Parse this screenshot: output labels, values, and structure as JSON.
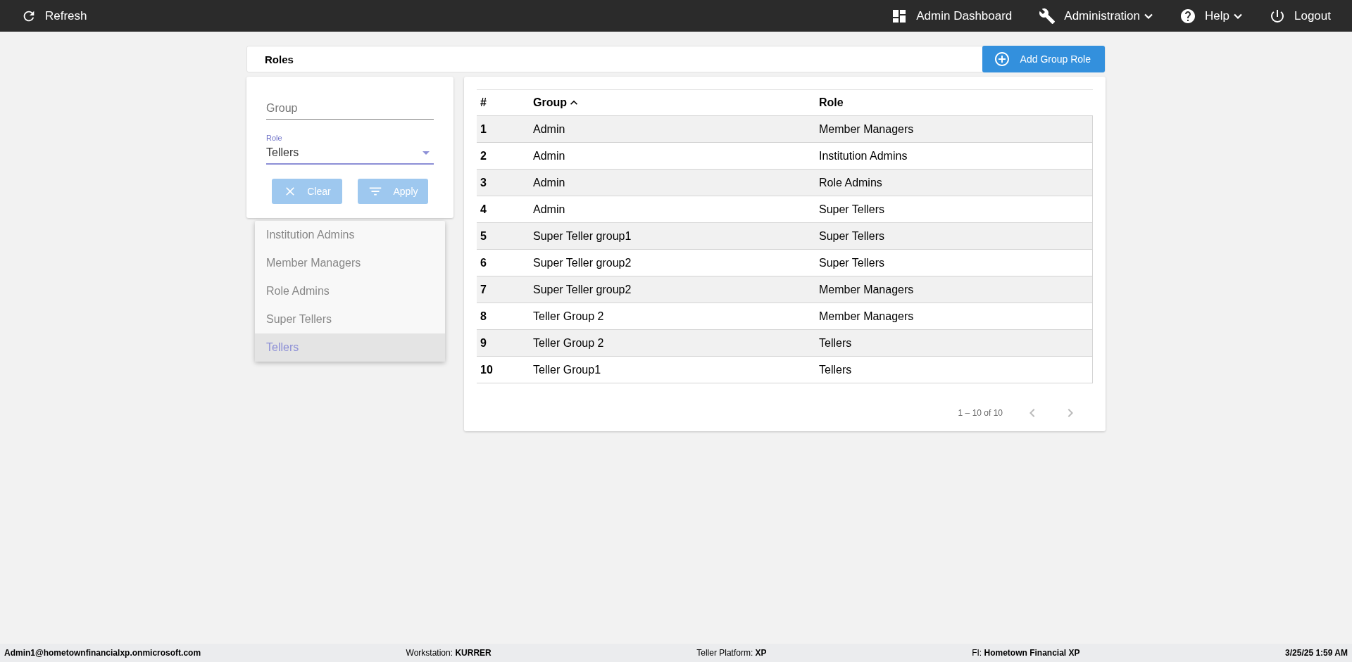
{
  "topbar": {
    "refresh": "Refresh",
    "menu": [
      {
        "kind": "dashboard",
        "label": "Admin Dashboard",
        "dropdown": false
      },
      {
        "kind": "wrench",
        "label": "Administration",
        "dropdown": true
      },
      {
        "kind": "help",
        "label": "Help",
        "dropdown": true
      },
      {
        "kind": "power",
        "label": "Logout",
        "dropdown": false
      }
    ]
  },
  "header": {
    "title": "Roles",
    "add_button": "Add Group Role"
  },
  "filter": {
    "group": {
      "placeholder": "Group"
    },
    "role": {
      "label": "Role",
      "value": "Tellers"
    },
    "clear": "Clear",
    "apply": "Apply",
    "options": [
      {
        "label": "Institution Admins",
        "selected": false
      },
      {
        "label": "Member Managers",
        "selected": false
      },
      {
        "label": "Role Admins",
        "selected": false
      },
      {
        "label": "Super Tellers",
        "selected": false
      },
      {
        "label": "Tellers",
        "selected": true
      }
    ]
  },
  "table": {
    "columns": [
      {
        "label": "#",
        "sorted": false
      },
      {
        "label": "Group",
        "sorted": true
      },
      {
        "label": "Role",
        "sorted": false
      }
    ],
    "rows": [
      [
        "1",
        "Admin",
        "Member Managers"
      ],
      [
        "2",
        "Admin",
        "Institution Admins"
      ],
      [
        "3",
        "Admin",
        "Role Admins"
      ],
      [
        "4",
        "Admin",
        "Super Tellers"
      ],
      [
        "5",
        "Super Teller group1",
        "Super Tellers"
      ],
      [
        "6",
        "Super Teller group2",
        "Super Tellers"
      ],
      [
        "7",
        "Super Teller group2",
        "Member Managers"
      ],
      [
        "8",
        "Teller Group 2",
        "Member Managers"
      ],
      [
        "9",
        "Teller Group 2",
        "Tellers"
      ],
      [
        "10",
        "Teller Group1",
        "Tellers"
      ]
    ],
    "range": "1 – 10 of 10"
  },
  "status_bar": [
    {
      "value": "Admin1@hometownfinancialxp.onmicrosoft.com"
    },
    {
      "label": "Workstation:",
      "value": "KURRER"
    },
    {
      "label": "Teller Platform:",
      "value": "XP"
    },
    {
      "label": "FI:",
      "value": "Hometown Financial XP"
    },
    {
      "value": "3/25/25 1:59 AM"
    }
  ]
}
